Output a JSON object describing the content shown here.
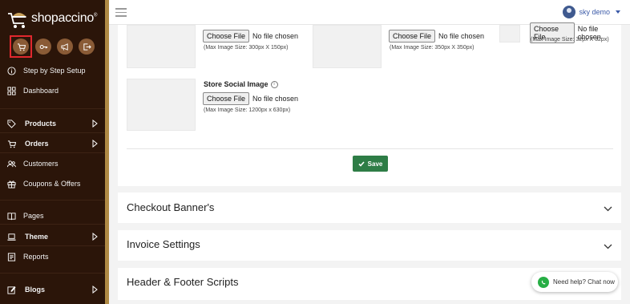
{
  "brand": {
    "logo_text": "shopaccino",
    "trademark": "®"
  },
  "sidebar": {
    "quick_icons": [
      "cart-icon",
      "key-icon",
      "megaphone-icon",
      "logout-icon"
    ],
    "items": [
      {
        "label": "Step by Step Setup",
        "icon": "info-icon",
        "bold": false,
        "chevron": false
      },
      {
        "label": "Dashboard",
        "icon": "dashboard-icon",
        "bold": false,
        "chevron": false
      },
      {
        "label": "Products",
        "icon": "tag-icon",
        "bold": true,
        "chevron": true
      },
      {
        "label": "Orders",
        "icon": "cart-icon",
        "bold": true,
        "chevron": true
      },
      {
        "label": "Customers",
        "icon": "users-icon",
        "bold": false,
        "chevron": false
      },
      {
        "label": "Coupons & Offers",
        "icon": "gift-icon",
        "bold": false,
        "chevron": false
      },
      {
        "label": "Pages",
        "icon": "book-icon",
        "bold": false,
        "chevron": false
      },
      {
        "label": "Theme",
        "icon": "laptop-icon",
        "bold": true,
        "chevron": true
      },
      {
        "label": "Reports",
        "icon": "report-icon",
        "bold": false,
        "chevron": false
      },
      {
        "label": "Blogs",
        "icon": "edit-icon",
        "bold": true,
        "chevron": true
      }
    ]
  },
  "topbar": {
    "user_name": "sky demo"
  },
  "uploads": {
    "choose_file": "Choose File",
    "no_file": "No file chosen",
    "hint_1": "(Max Image Size: 300px X 150px)",
    "hint_2": "(Max Image Size: 350px X 350px)",
    "hint_3": "(Max Image Size: 32px X 32px)",
    "social_label": "Store Social Image",
    "hint_4": "(Max Image Size: 1200px x 630px)"
  },
  "save_label": "Save",
  "accordions": [
    "Checkout Banner's",
    "Invoice Settings",
    "Header & Footer Scripts"
  ],
  "chat": {
    "label": "Need help? Chat now"
  },
  "colors": {
    "sidebar_bg": "#2b1509",
    "accent_gold": "#b08a45",
    "save_green": "#2e7d46",
    "user_blue": "#3b5aa8"
  }
}
